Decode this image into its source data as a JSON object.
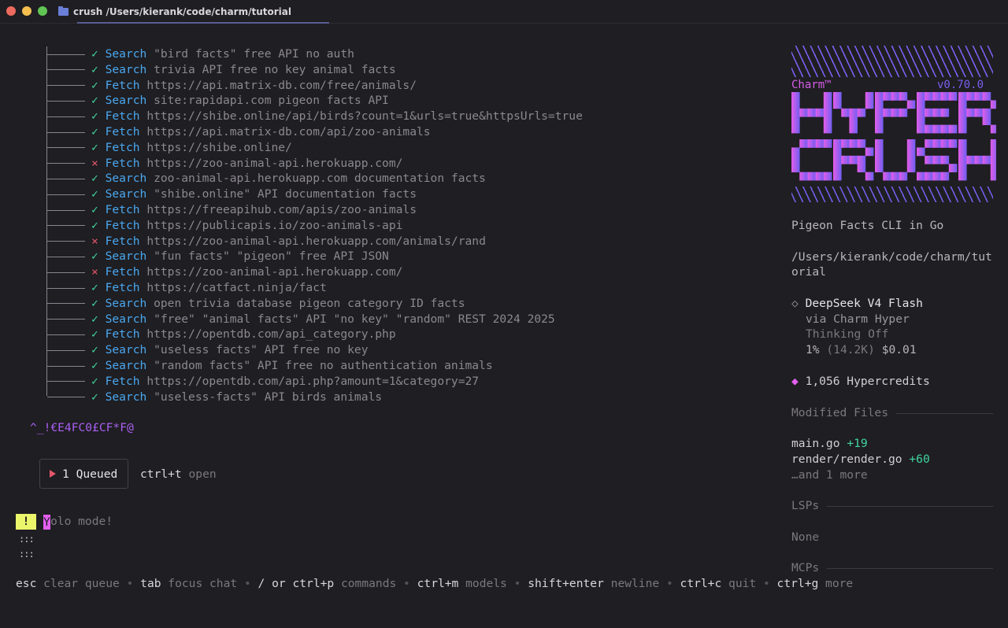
{
  "window": {
    "title": "crush /Users/kierank/code/charm/tutorial"
  },
  "tool_calls": [
    {
      "status": "ok",
      "kind": "Search",
      "args": "\"bird facts\" free API no auth"
    },
    {
      "status": "ok",
      "kind": "Search",
      "args": "trivia API free no key animal facts"
    },
    {
      "status": "ok",
      "kind": "Fetch",
      "args": "https://api.matrix-db.com/free/animals/"
    },
    {
      "status": "ok",
      "kind": "Search",
      "args": "site:rapidapi.com pigeon facts API"
    },
    {
      "status": "ok",
      "kind": "Fetch",
      "args": "https://shibe.online/api/birds?count=1&urls=true&httpsUrls=true"
    },
    {
      "status": "ok",
      "kind": "Fetch",
      "args": "https://api.matrix-db.com/api/zoo-animals"
    },
    {
      "status": "ok",
      "kind": "Fetch",
      "args": "https://shibe.online/"
    },
    {
      "status": "err",
      "kind": "Fetch",
      "args": "https://zoo-animal-api.herokuapp.com/"
    },
    {
      "status": "ok",
      "kind": "Search",
      "args": "zoo-animal-api.herokuapp.com documentation facts"
    },
    {
      "status": "ok",
      "kind": "Search",
      "args": "\"shibe.online\" API documentation facts"
    },
    {
      "status": "ok",
      "kind": "Fetch",
      "args": "https://freeapihub.com/apis/zoo-animals"
    },
    {
      "status": "ok",
      "kind": "Fetch",
      "args": "https://publicapis.io/zoo-animals-api"
    },
    {
      "status": "err",
      "kind": "Fetch",
      "args": "https://zoo-animal-api.herokuapp.com/animals/rand"
    },
    {
      "status": "ok",
      "kind": "Search",
      "args": "\"fun facts\" \"pigeon\" free API JSON"
    },
    {
      "status": "err",
      "kind": "Fetch",
      "args": "https://zoo-animal-api.herokuapp.com/"
    },
    {
      "status": "ok",
      "kind": "Fetch",
      "args": "https://catfact.ninja/fact"
    },
    {
      "status": "ok",
      "kind": "Search",
      "args": "open trivia database pigeon category ID facts"
    },
    {
      "status": "ok",
      "kind": "Search",
      "args": "\"free\" \"animal facts\" API \"no key\" \"random\" REST 2024 2025"
    },
    {
      "status": "ok",
      "kind": "Fetch",
      "args": "https://opentdb.com/api_category.php"
    },
    {
      "status": "ok",
      "kind": "Search",
      "args": "\"useless facts\" API free no key"
    },
    {
      "status": "ok",
      "kind": "Search",
      "args": "\"random facts\" API free no authentication animals"
    },
    {
      "status": "ok",
      "kind": "Fetch",
      "args": "https://opentdb.com/api.php?amount=1&category=27"
    },
    {
      "status": "ok",
      "kind": "Search",
      "args": "\"useless-facts\" API birds animals"
    }
  ],
  "status_glyphs": {
    "ok": "✓",
    "err": "×"
  },
  "garbled_text": "^_!€E4FC0£CF*F@",
  "queue": {
    "label": "1 Queued",
    "hint_key": "ctrl+t",
    "hint_desc": "open"
  },
  "prompt": {
    "badge": "!",
    "cursor_char": "Y",
    "text": "olo mode!",
    "dots": ":::"
  },
  "footer": [
    {
      "key": "esc",
      "desc": "clear queue"
    },
    {
      "key": "tab",
      "desc": "focus chat"
    },
    {
      "key": "/ or ctrl+p",
      "desc": "commands"
    },
    {
      "key": "ctrl+m",
      "desc": "models"
    },
    {
      "key": "shift+enter",
      "desc": "newline"
    },
    {
      "key": "ctrl+c",
      "desc": "quit"
    },
    {
      "key": "ctrl+g",
      "desc": "more"
    }
  ],
  "footer_separator": "•",
  "sidebar": {
    "brand": "Charm™",
    "version": "v0.70.0",
    "logo_words": [
      "HYPER",
      "CRUSH"
    ],
    "logo_colors": {
      "start": "#e35de9",
      "end": "#6f5ef2"
    },
    "session_title": "Pigeon Facts CLI in Go",
    "cwd_line1": "/Users/kierank/code/charm/tut",
    "cwd_line2": "orial",
    "model": {
      "name": "DeepSeek V4 Flash",
      "provider": "via Charm Hyper",
      "thinking": "Thinking Off",
      "usage_pct": "1%",
      "usage_tokens": "(14.2K)",
      "cost": "$0.01"
    },
    "credits": "1,056 Hypercredits",
    "modified_files_title": "Modified Files",
    "files": [
      {
        "name": "main.go",
        "delta": "+19"
      },
      {
        "name": "render/render.go",
        "delta": "+60"
      }
    ],
    "more_files": "…and 1 more",
    "lsps_title": "LSPs",
    "lsps_value": "None",
    "mcps_title": "MCPs"
  }
}
